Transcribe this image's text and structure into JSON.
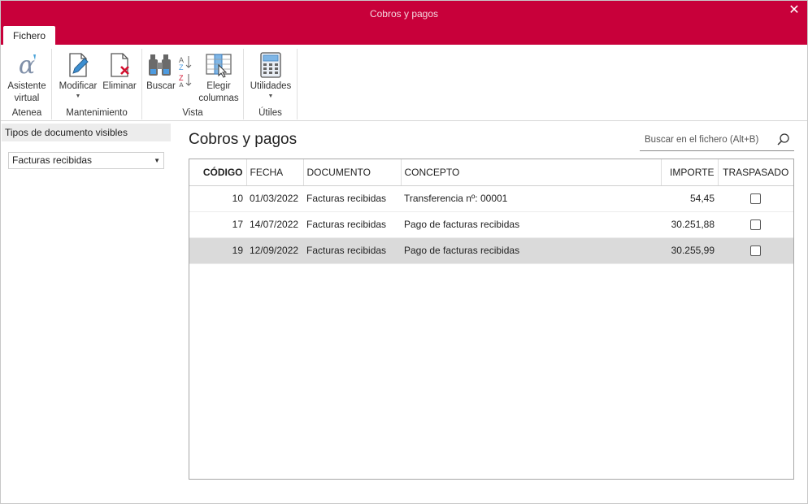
{
  "window": {
    "title": "Cobros y pagos",
    "close_glyph": "✕"
  },
  "ribbon": {
    "active_tab": "Fichero",
    "groups": [
      {
        "label": "Atenea",
        "buttons": [
          {
            "label": "Asistente virtual",
            "icon": "alpha-assistant-icon"
          }
        ]
      },
      {
        "label": "Mantenimiento",
        "buttons": [
          {
            "label": "Modificar",
            "icon": "edit-document-icon",
            "has_dropdown": true
          },
          {
            "label": "Eliminar",
            "icon": "delete-document-icon"
          }
        ]
      },
      {
        "label": "Vista",
        "buttons": [
          {
            "label": "Buscar",
            "icon": "binoculars-icon"
          },
          {
            "label": "sort-az",
            "icon": "sort-az-icon"
          },
          {
            "label": "Elegir columnas",
            "icon": "choose-columns-icon"
          }
        ]
      },
      {
        "label": "Útiles",
        "buttons": [
          {
            "label": "Utilidades",
            "icon": "calculator-icon",
            "has_dropdown": true
          }
        ]
      }
    ]
  },
  "left_panel": {
    "header": "Tipos de documento visibles",
    "selected_type": "Facturas recibidas"
  },
  "main": {
    "title": "Cobros y pagos",
    "search_placeholder": "Buscar en el fichero (Alt+B)"
  },
  "table": {
    "columns": [
      "CÓDIGO",
      "FECHA",
      "DOCUMENTO",
      "CONCEPTO",
      "IMPORTE",
      "TRASPASADO"
    ],
    "sorted_column": "CÓDIGO",
    "rows": [
      {
        "codigo": "10",
        "fecha": "01/03/2022",
        "documento": "Facturas recibidas",
        "concepto": "Transferencia nº: 00001",
        "importe": "54,45",
        "traspasado": false
      },
      {
        "codigo": "17",
        "fecha": "14/07/2022",
        "documento": "Facturas recibidas",
        "concepto": "Pago de facturas recibidas",
        "importe": "30.251,88",
        "traspasado": false
      },
      {
        "codigo": "19",
        "fecha": "12/09/2022",
        "documento": "Facturas recibidas",
        "concepto": "Pago de facturas recibidas",
        "importe": "30.255,99",
        "traspasado": false
      }
    ],
    "selected_row_index": 2
  },
  "colors": {
    "accent": "#c8003a",
    "selected_row": "#dadada"
  }
}
